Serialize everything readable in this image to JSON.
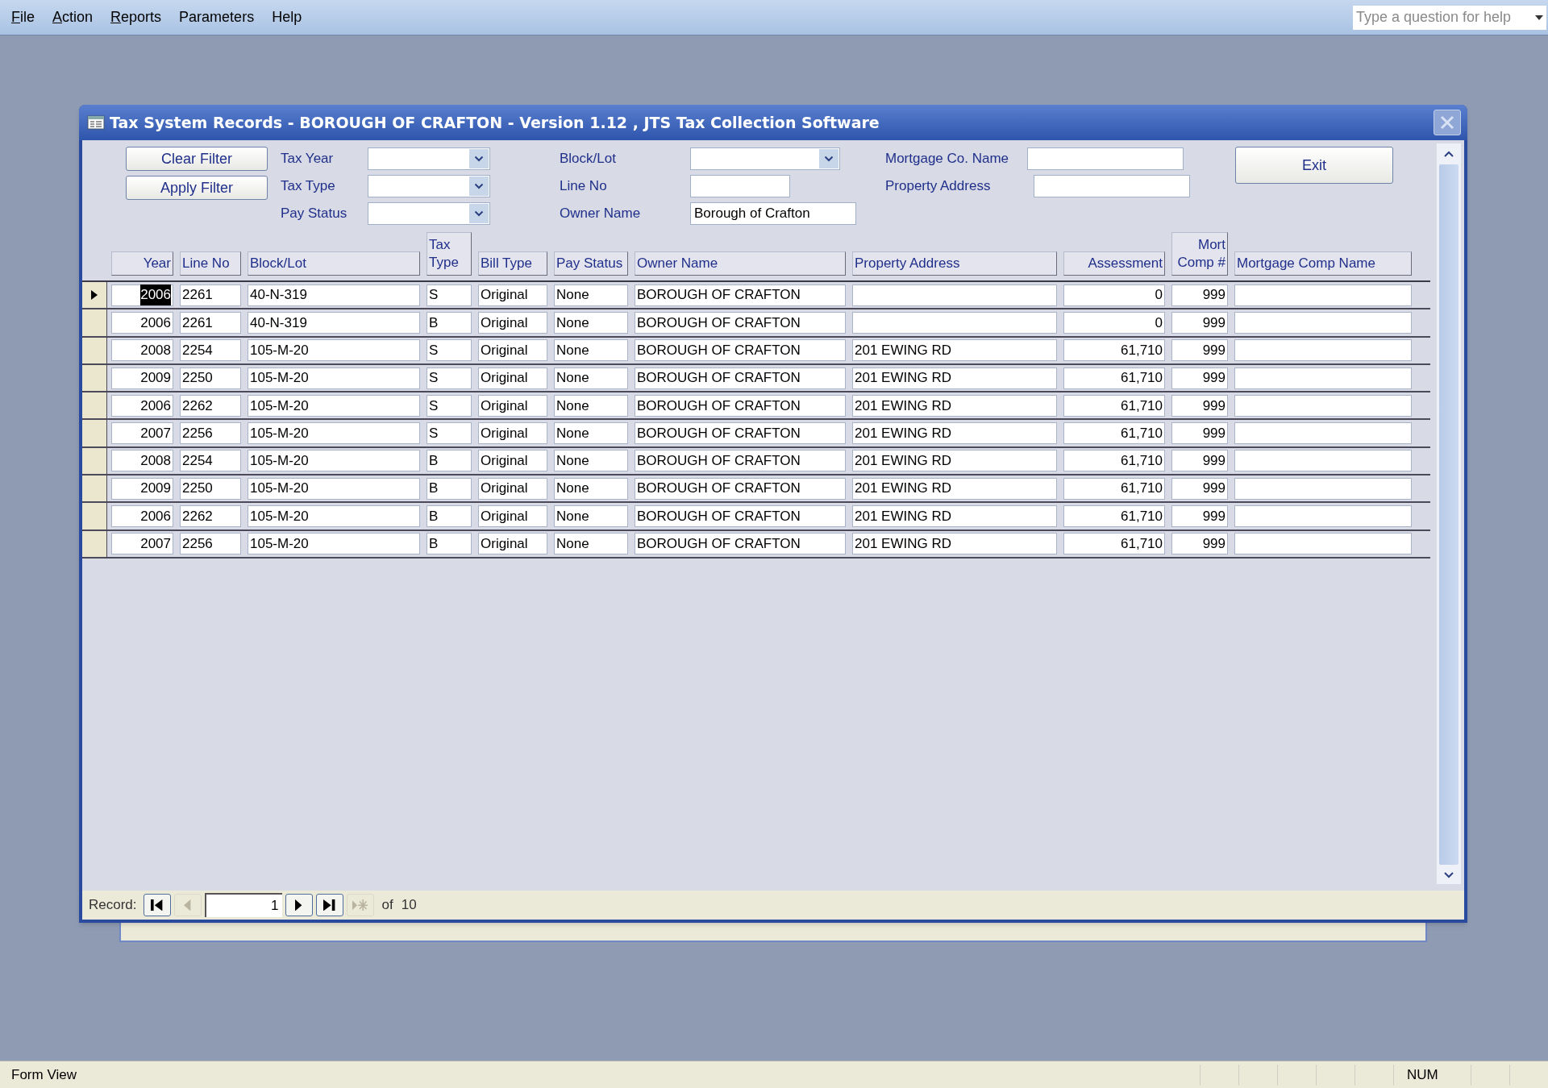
{
  "menu": [
    {
      "label": "File",
      "access_key": true
    },
    {
      "label": "Action",
      "access_key": true
    },
    {
      "label": "Reports",
      "access_key": true
    },
    {
      "label": "Parameters",
      "access_key": false
    },
    {
      "label": "Help",
      "access_key": false
    }
  ],
  "help_box": {
    "placeholder": "Type a question for help"
  },
  "window": {
    "title": "Tax System Records - BOROUGH OF CRAFTON - Version 1.12 ,  JTS Tax Collection Software"
  },
  "filter_buttons": [
    "Clear Filter",
    "Apply Filter"
  ],
  "filter_columns": [
    [
      {
        "label": "Tax Year",
        "kind": "dropdown"
      },
      {
        "label": "Tax Type",
        "kind": "dropdown"
      },
      {
        "label": "Pay Status",
        "kind": "dropdown"
      }
    ],
    [
      {
        "label": "Block/Lot",
        "kind": "dropdown"
      },
      {
        "label": "Line No",
        "kind": "text"
      },
      {
        "label": "Owner Name",
        "kind": "text",
        "value": "Borough of Crafton"
      }
    ],
    [
      {
        "label": "Mortgage Co. Name",
        "kind": "text"
      },
      {
        "label": "Property Address",
        "kind": "text"
      }
    ]
  ],
  "exit_button": "Exit",
  "table": {
    "columns": [
      {
        "label": "Year",
        "kind": "number"
      },
      {
        "label": "Line No",
        "kind": "text"
      },
      {
        "label": "Block/Lot",
        "kind": "text"
      },
      {
        "label": "Tax Type",
        "kind": "text"
      },
      {
        "label": "Bill Type",
        "kind": "text"
      },
      {
        "label": "Pay Status",
        "kind": "text"
      },
      {
        "label": "Owner Name",
        "kind": "text"
      },
      {
        "label": "Property Address",
        "kind": "text"
      },
      {
        "label": "Assessment",
        "kind": "number"
      },
      {
        "label": "Mort Comp #",
        "kind": "number"
      },
      {
        "label": "Mortgage Comp Name",
        "kind": "text"
      }
    ],
    "rows": [
      {
        "selected": true,
        "cells": [
          "2006",
          "2261",
          "40-N-319",
          "S",
          "Original",
          "None",
          "BOROUGH OF CRAFTON",
          "",
          "0",
          "999",
          ""
        ]
      },
      {
        "selected": false,
        "cells": [
          "2006",
          "2261",
          "40-N-319",
          "B",
          "Original",
          "None",
          "BOROUGH OF CRAFTON",
          "",
          "0",
          "999",
          ""
        ]
      },
      {
        "selected": false,
        "cells": [
          "2008",
          "2254",
          "105-M-20",
          "S",
          "Original",
          "None",
          "BOROUGH OF CRAFTON",
          "201 EWING RD",
          "61,710",
          "999",
          ""
        ]
      },
      {
        "selected": false,
        "cells": [
          "2009",
          "2250",
          "105-M-20",
          "S",
          "Original",
          "None",
          "BOROUGH OF CRAFTON",
          "201 EWING RD",
          "61,710",
          "999",
          ""
        ]
      },
      {
        "selected": false,
        "cells": [
          "2006",
          "2262",
          "105-M-20",
          "S",
          "Original",
          "None",
          "BOROUGH OF CRAFTON",
          "201 EWING RD",
          "61,710",
          "999",
          ""
        ]
      },
      {
        "selected": false,
        "cells": [
          "2007",
          "2256",
          "105-M-20",
          "S",
          "Original",
          "None",
          "BOROUGH OF CRAFTON",
          "201 EWING RD",
          "61,710",
          "999",
          ""
        ]
      },
      {
        "selected": false,
        "cells": [
          "2008",
          "2254",
          "105-M-20",
          "B",
          "Original",
          "None",
          "BOROUGH OF CRAFTON",
          "201 EWING RD",
          "61,710",
          "999",
          ""
        ]
      },
      {
        "selected": false,
        "cells": [
          "2009",
          "2250",
          "105-M-20",
          "B",
          "Original",
          "None",
          "BOROUGH OF CRAFTON",
          "201 EWING RD",
          "61,710",
          "999",
          ""
        ]
      },
      {
        "selected": false,
        "cells": [
          "2006",
          "2262",
          "105-M-20",
          "B",
          "Original",
          "None",
          "BOROUGH OF CRAFTON",
          "201 EWING RD",
          "61,710",
          "999",
          ""
        ]
      },
      {
        "selected": false,
        "cells": [
          "2007",
          "2256",
          "105-M-20",
          "B",
          "Original",
          "None",
          "BOROUGH OF CRAFTON",
          "201 EWING RD",
          "61,710",
          "999",
          ""
        ]
      }
    ]
  },
  "record_nav": {
    "label": "Record:",
    "current": "1",
    "of": "of",
    "total": "10",
    "buttons": [
      {
        "kind": "first",
        "disabled": false
      },
      {
        "kind": "prev",
        "disabled": true
      },
      {
        "kind": "next",
        "disabled": false
      },
      {
        "kind": "last",
        "disabled": false
      },
      {
        "kind": "new",
        "disabled": true
      }
    ]
  },
  "status_bar": {
    "text": "Form View",
    "indicators": [
      "NUM"
    ]
  }
}
